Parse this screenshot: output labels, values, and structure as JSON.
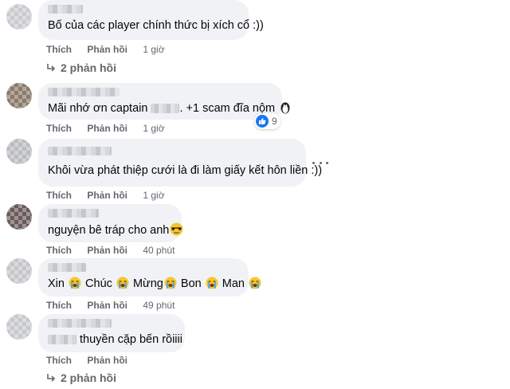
{
  "actions": {
    "like": "Thích",
    "reply": "Phản hồi"
  },
  "comments": [
    {
      "text": "Bố của các player chính thức bị xích cổ :))",
      "time": "1 giờ",
      "replies": "2 phản hồi"
    },
    {
      "text_before": "Mãi nhớ ơn captain",
      "text_after": ". +1 scam đĩa nộm",
      "time": "1 giờ",
      "reaction_count": "9"
    },
    {
      "text": "Khôi vừa phát thiệp cưới là đi làm giấy kết hôn liền :))",
      "time": "1 giờ"
    },
    {
      "text": "nguyện bê tráp cho anh",
      "time": "40 phút"
    },
    {
      "words": [
        "Xin",
        "Chúc",
        "Mừng",
        "Bon",
        "Man"
      ],
      "time": "49 phút"
    },
    {
      "text": "thuyền cặp bến rồiiii",
      "time": "",
      "replies": "2 phản hồi"
    }
  ],
  "icons": {
    "reply_arrow": "reply-arrow-icon",
    "penguin": "penguin-emoji",
    "cool": "sunglasses-emoji",
    "cry": "loudly-crying-emoji",
    "like_reaction": "like-reaction-icon",
    "more": "more-options-icon"
  },
  "colors": {
    "bubble": "#f0f2f5",
    "secondary_text": "#65676b",
    "like_blue": "#1877f2"
  }
}
